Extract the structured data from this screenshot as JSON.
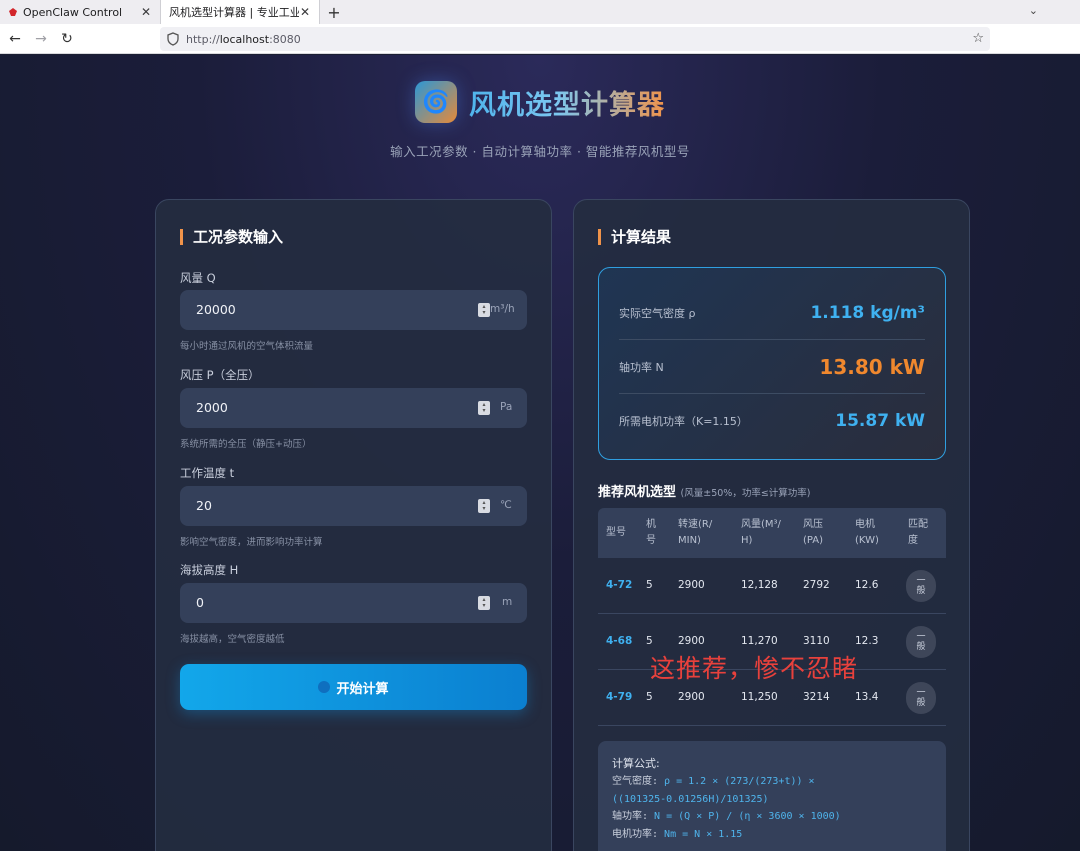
{
  "browser": {
    "tabs": [
      {
        "title": "OpenClaw Control",
        "active": false
      },
      {
        "title": "风机选型计算器 | 专业工业通",
        "active": true
      }
    ],
    "url_prefix": "http://",
    "url_host": "localhost",
    "url_port": ":8080"
  },
  "header": {
    "logo_icon": "fan-swirl-icon",
    "title": "风机选型计算器",
    "subtitle": "输入工况参数 · 自动计算轴功率 · 智能推荐风机型号"
  },
  "inputs": {
    "section_title": "工况参数输入",
    "flow": {
      "label": "风量 Q",
      "value": "20000",
      "unit": "m³/h",
      "hint": "每小时通过风机的空气体积流量"
    },
    "pressure": {
      "label": "风压 P（全压）",
      "value": "2000",
      "unit": "Pa",
      "hint": "系统所需的全压（静压+动压）"
    },
    "temperature": {
      "label": "工作温度 t",
      "value": "20",
      "unit": "℃",
      "hint": "影响空气密度，进而影响功率计算"
    },
    "altitude": {
      "label": "海拔高度 H",
      "value": "0",
      "unit": "m",
      "hint": "海拔越高，空气密度越低"
    },
    "calc_button": "开始计算"
  },
  "results": {
    "section_title": "计算结果",
    "density": {
      "label": "实际空气密度 ρ",
      "value": "1.118 kg/m³"
    },
    "shaft_power": {
      "label": "轴功率 N",
      "value": "13.80 kW"
    },
    "motor_power": {
      "label": "所需电机功率（K=1.15）",
      "value": "15.87 kW"
    }
  },
  "recommend": {
    "title": "推荐风机选型",
    "note": "(风量±50%，功率≤计算功率)",
    "headers": [
      "型号",
      "机号",
      "转速(R/MIN)",
      "风量(M³/H)",
      "风压(PA)",
      "电机(KW)",
      "匹配度"
    ],
    "header_lines": [
      [
        "型号"
      ],
      [
        "机",
        "号"
      ],
      [
        "转速(R/",
        "MIN)"
      ],
      [
        "风量(M³/",
        "H)"
      ],
      [
        "风压",
        "(PA)"
      ],
      [
        "电机",
        "(KW)"
      ],
      [
        "匹配",
        "度"
      ]
    ],
    "rows": [
      {
        "model": "4-72",
        "no": "5",
        "rpm": "2900",
        "flow": "12,128",
        "pressure": "2792",
        "motor": "12.6",
        "match": "一般"
      },
      {
        "model": "4-68",
        "no": "5",
        "rpm": "2900",
        "flow": "11,270",
        "pressure": "3110",
        "motor": "12.3",
        "match": "一般"
      },
      {
        "model": "4-79",
        "no": "5",
        "rpm": "2900",
        "flow": "11,250",
        "pressure": "3214",
        "motor": "13.4",
        "match": "一般"
      }
    ]
  },
  "overlay_comment": "这推荐，惨不忍睹",
  "formula": {
    "title": "计算公式:",
    "density_label": "空气密度: ",
    "density_code_1": "ρ = 1.2 × (273/(273+t)) ×",
    "density_code_2": "((101325-0.01256H)/101325)",
    "shaft_label": "轴功率: ",
    "shaft_code": "N = (Q × P) / (η × 3600 × 1000)",
    "motor_label": "电机功率: ",
    "motor_code": "Nm = N × 1.15"
  },
  "colors": {
    "accent_blue": "#3fb1f0",
    "accent_orange": "#f0882e",
    "overlay_red": "#e8413c"
  }
}
